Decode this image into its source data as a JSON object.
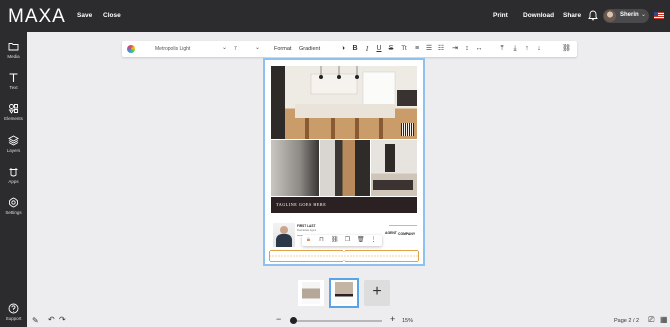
{
  "app": {
    "logo": "MAXA",
    "save": "Save",
    "close": "Close",
    "print": "Print",
    "download": "Download",
    "share": "Share",
    "user_name": "Sherin"
  },
  "sidebar": {
    "items": [
      {
        "label": "Media",
        "icon": "folder-icon"
      },
      {
        "label": "Text",
        "icon": "text-icon"
      },
      {
        "label": "Elements",
        "icon": "elements-icon"
      },
      {
        "label": "Layers",
        "icon": "layers-icon"
      },
      {
        "label": "Apps",
        "icon": "apps-icon"
      },
      {
        "label": "Settings",
        "icon": "gear-icon"
      }
    ],
    "support": "Support"
  },
  "toolbar": {
    "font": "Metropolis Light",
    "size": "7",
    "format": "Format",
    "gradient": "Gradient",
    "case_label": "Tt"
  },
  "document": {
    "tagline": "TAGLINE GOES HERE",
    "agent_name": "FIRST LAST",
    "agent_sub": "Real Estate Agent",
    "company": "COMPANY",
    "agent_badge": "AGENT",
    "qr_label": "QR"
  },
  "footer": {
    "zoom": "15%",
    "page_indicator": "Page 2 / 2"
  },
  "colors": {
    "topbar": "#2c2c2e",
    "selection": "#8ec1ef",
    "tagline_bar": "#2b2022",
    "handles": "#e0a34a"
  }
}
